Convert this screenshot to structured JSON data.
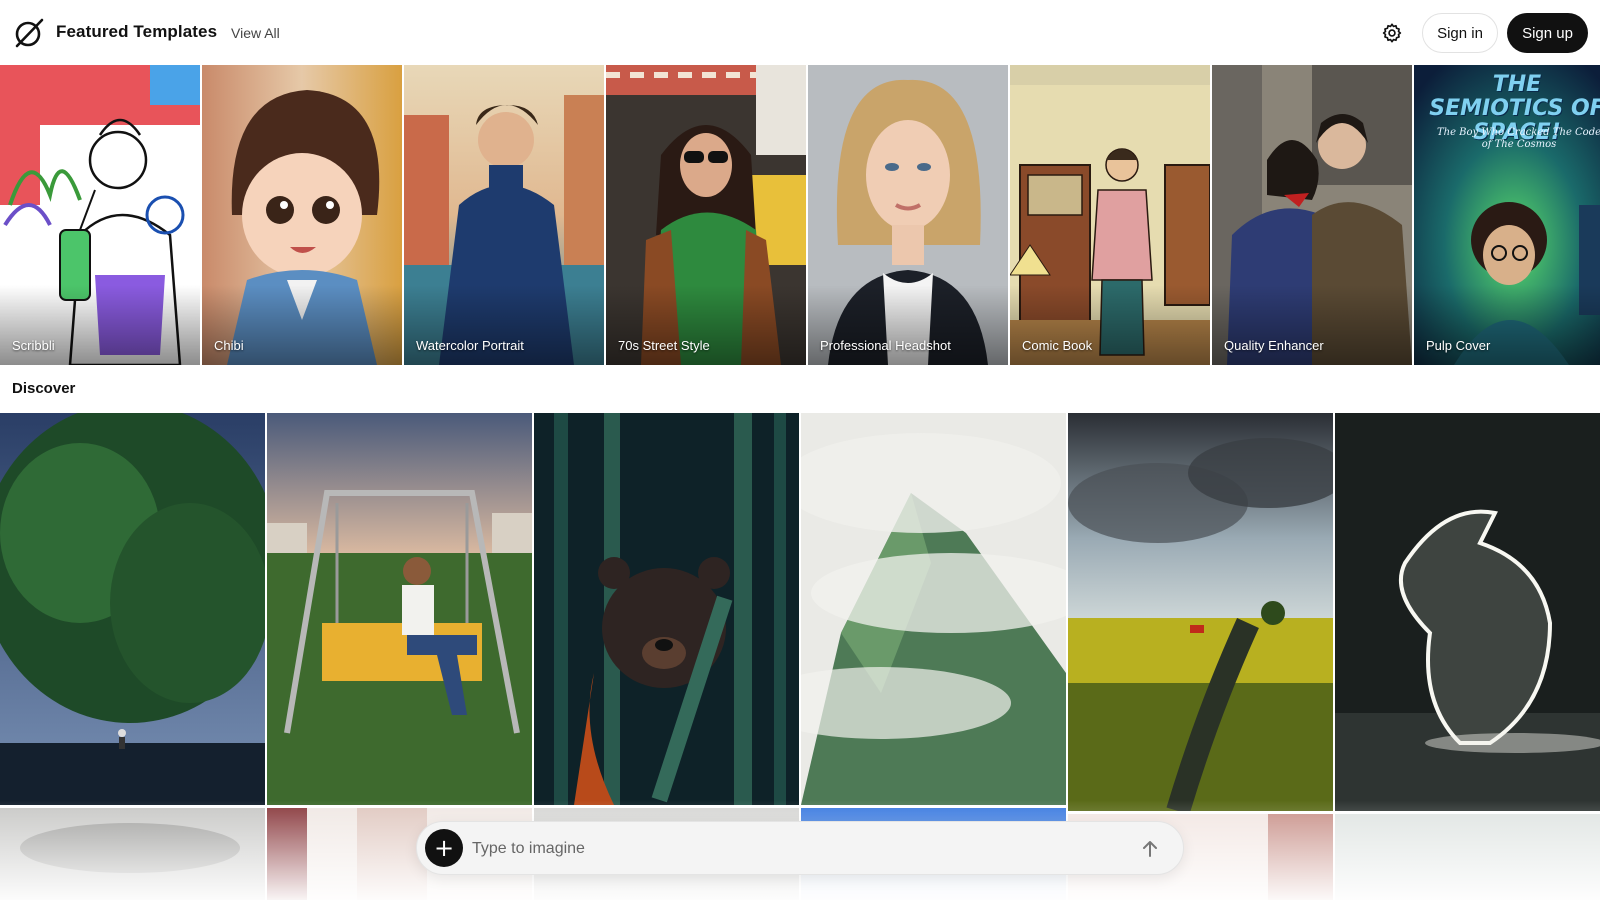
{
  "header": {
    "brand": "Featured Templates",
    "view_all": "View All",
    "logo_icon": "slashed-circle-logo-icon",
    "settings_icon": "gear-icon",
    "sign_in": "Sign in",
    "sign_up": "Sign up"
  },
  "templates": [
    {
      "label": "Scribbli"
    },
    {
      "label": "Chibi"
    },
    {
      "label": "Watercolor Portrait"
    },
    {
      "label": "70s Street Style"
    },
    {
      "label": "Professional Headshot"
    },
    {
      "label": "Comic Book"
    },
    {
      "label": "Quality Enhancer"
    },
    {
      "label": "Pulp Cover"
    }
  ],
  "pulp_cover_text": {
    "headline": "THE SEMIOTICS OF SPACE!",
    "subline": "The Boy Who Cracked The Code of The Cosmos"
  },
  "discover": {
    "title": "Discover"
  },
  "prompt": {
    "placeholder": "Type to imagine",
    "add_icon": "plus-icon",
    "send_icon": "arrow-up-icon"
  },
  "colors": {
    "primary_button": "#111111",
    "background": "#ffffff",
    "prompt_bg": "#f4f4f4"
  }
}
